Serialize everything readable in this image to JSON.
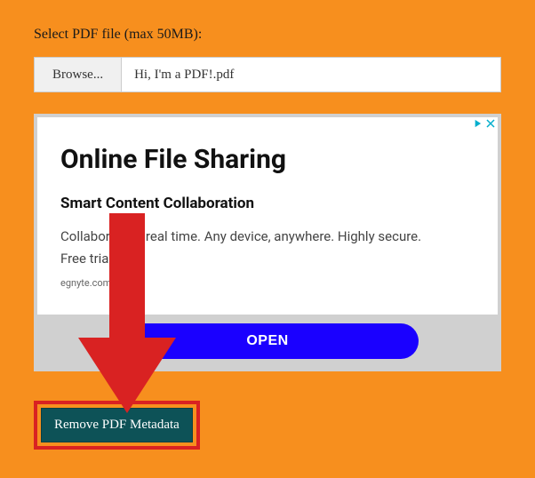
{
  "form": {
    "label": "Select PDF file (max 50MB):",
    "browse_label": "Browse...",
    "file_name": "Hi, I'm a PDF!.pdf"
  },
  "ad": {
    "heading": "Online File Sharing",
    "subheading": "Smart Content Collaboration",
    "body_line1": "Collaborate in real time. Any device, anywhere. Highly secure.",
    "body_line2": "Free trial",
    "domain": "egnyte.com",
    "open_label": "OPEN"
  },
  "action": {
    "label": "Remove PDF Metadata"
  },
  "colors": {
    "page_bg": "#f78f1e",
    "arrow": "#d92222",
    "action_bg": "#0d5257",
    "open_bg": "#1a00ff"
  }
}
